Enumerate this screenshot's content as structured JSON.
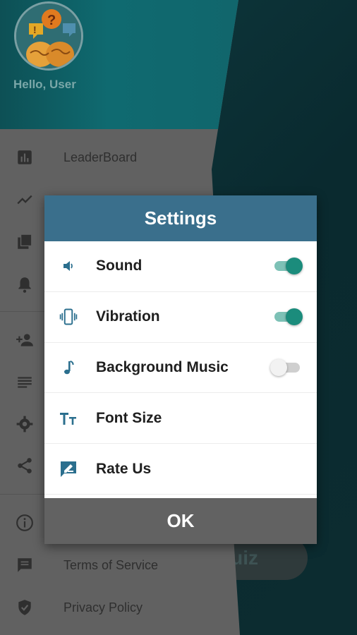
{
  "colors": {
    "header_teal": "#0f6a70",
    "dialog_title_bg": "#3a6f8c",
    "toggle_on": "#1b8c7c",
    "ok_button_bg": "#626262",
    "icon_blue": "#2b6f8e"
  },
  "drawer": {
    "greeting": "Hello, User",
    "items": [
      {
        "label": "LeaderBoard",
        "icon": "leaderboard-icon"
      },
      {
        "label": "",
        "icon": "trend-icon"
      },
      {
        "label": "",
        "icon": "bookmarks-icon"
      },
      {
        "label": "",
        "icon": "bell-icon"
      },
      {
        "label": "",
        "icon": "add-user-icon"
      },
      {
        "label": "",
        "icon": "list-icon"
      },
      {
        "label": "",
        "icon": "gear-icon"
      },
      {
        "label": "",
        "icon": "share-icon"
      },
      {
        "label": "",
        "icon": "info-icon"
      },
      {
        "label": "Terms of Service",
        "icon": "message-icon"
      },
      {
        "label": "Privacy Policy",
        "icon": "shield-icon"
      }
    ]
  },
  "background": {
    "pill_text": "uiz"
  },
  "dialog": {
    "title": "Settings",
    "rows": [
      {
        "label": "Sound",
        "icon": "speaker-icon",
        "toggle": true
      },
      {
        "label": "Vibration",
        "icon": "vibration-icon",
        "toggle": true
      },
      {
        "label": "Background Music",
        "icon": "music-note-icon",
        "toggle": false
      },
      {
        "label": "Font Size",
        "icon": "font-size-icon"
      },
      {
        "label": "Rate Us",
        "icon": "rate-icon"
      }
    ],
    "ok_label": "OK"
  }
}
